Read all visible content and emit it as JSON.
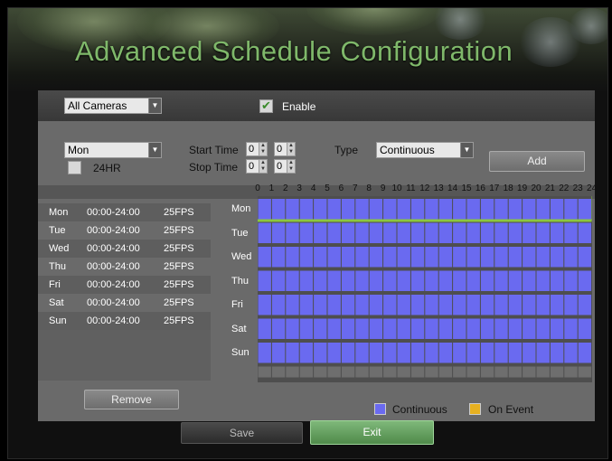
{
  "title": "Advanced Schedule Configuration",
  "camera_select": {
    "value": "All Cameras"
  },
  "enable": {
    "label": "Enable",
    "checked": true
  },
  "day_select": {
    "value": "Mon"
  },
  "allday": {
    "label": "24HR",
    "checked": false
  },
  "start_time": {
    "label": "Start Time",
    "hour": "0",
    "minute": "0"
  },
  "stop_time": {
    "label": "Stop Time",
    "hour": "0",
    "minute": "0"
  },
  "type": {
    "label": "Type",
    "value": "Continuous"
  },
  "add_label": "Add",
  "schedule_list": [
    {
      "day": "Mon",
      "time": "00:00-24:00",
      "fps": "25FPS"
    },
    {
      "day": "Tue",
      "time": "00:00-24:00",
      "fps": "25FPS"
    },
    {
      "day": "Wed",
      "time": "00:00-24:00",
      "fps": "25FPS"
    },
    {
      "day": "Thu",
      "time": "00:00-24:00",
      "fps": "25FPS"
    },
    {
      "day": "Fri",
      "time": "00:00-24:00",
      "fps": "25FPS"
    },
    {
      "day": "Sat",
      "time": "00:00-24:00",
      "fps": "25FPS"
    },
    {
      "day": "Sun",
      "time": "00:00-24:00",
      "fps": "25FPS"
    }
  ],
  "timeline": {
    "hours": [
      "0",
      "1",
      "2",
      "3",
      "4",
      "5",
      "6",
      "7",
      "8",
      "9",
      "10",
      "11",
      "12",
      "13",
      "14",
      "15",
      "16",
      "17",
      "18",
      "19",
      "20",
      "21",
      "22",
      "23",
      "24"
    ],
    "days": [
      "Mon",
      "Tue",
      "Wed",
      "Thu",
      "Fri",
      "Sat",
      "Sun"
    ],
    "continuous_hours": 24,
    "selected_day": "Mon"
  },
  "remove_label": "Remove",
  "legend": {
    "continuous": "Continuous",
    "on_event": "On Event"
  },
  "colors": {
    "continuous": "#6a6af0",
    "on_event": "#e6b020",
    "selected": "#8cc63f",
    "title": "#7fb86a"
  },
  "footer": {
    "save": "Save",
    "exit": "Exit"
  }
}
